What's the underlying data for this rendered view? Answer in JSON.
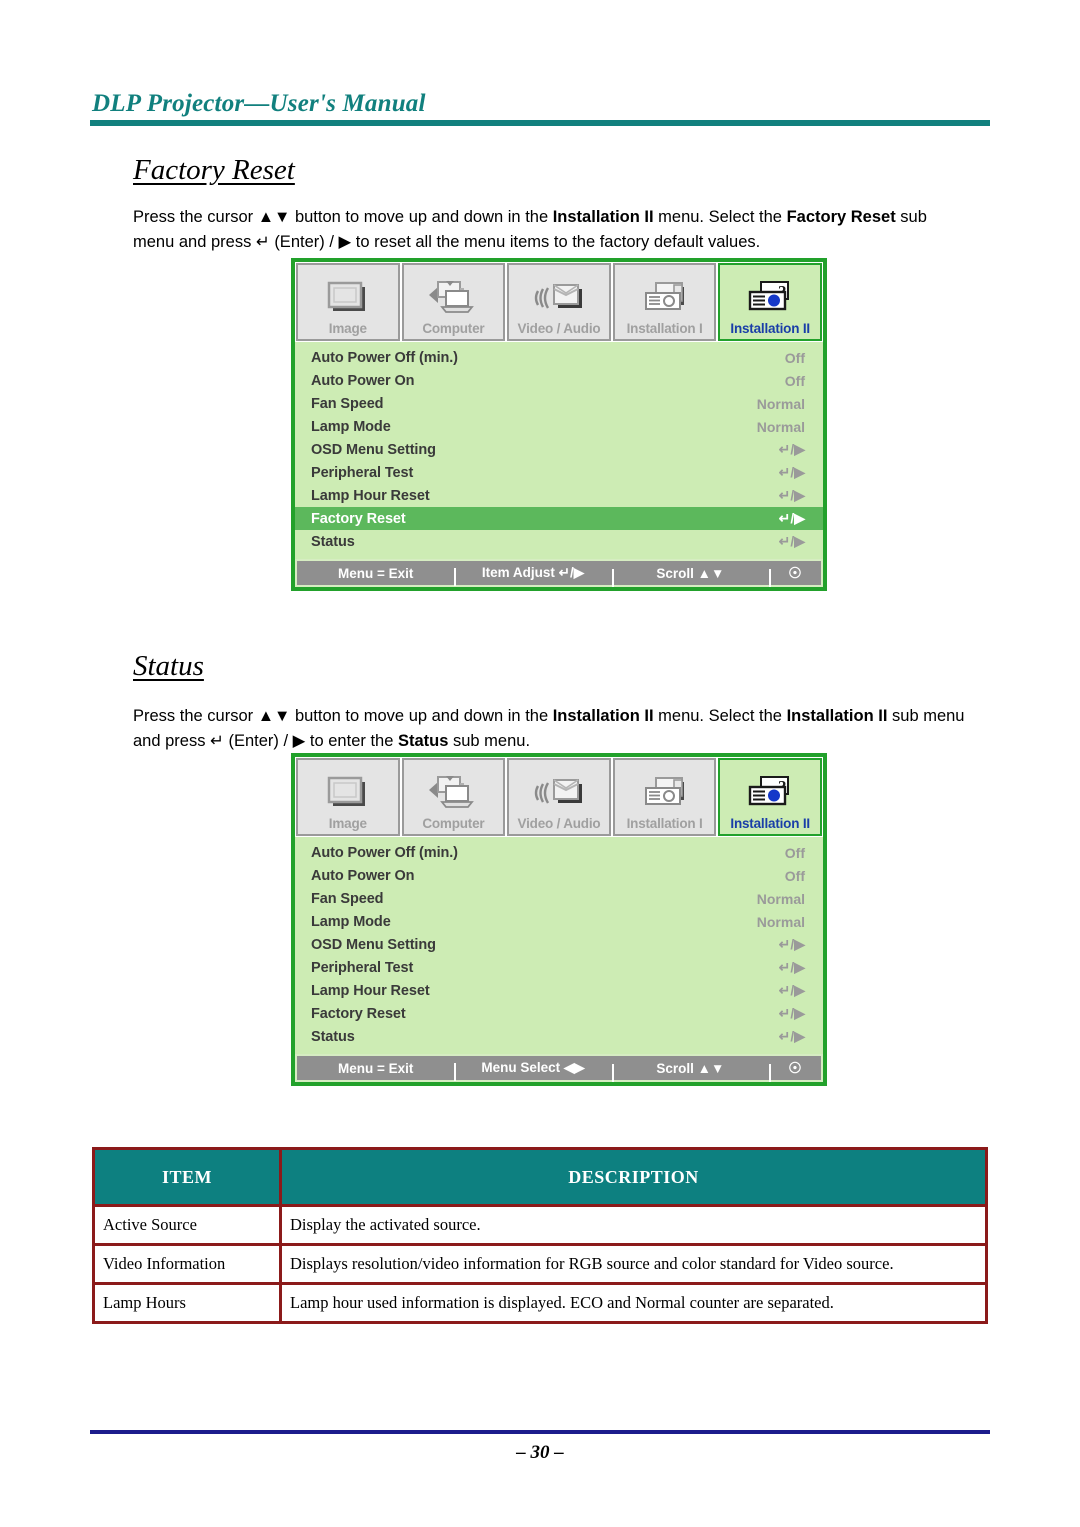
{
  "header": {
    "title": "DLP Projector—User's Manual",
    "rule_color": "#11807e"
  },
  "sections": [
    {
      "heading": "Factory Reset",
      "paragraph_html": "Press the cursor ▲▼ button to move up and down in the <b>Installation II</b> menu. Select the <b>Factory Reset</b> sub menu and press ↵ (Enter) / ▶ to reset all the menu items to the factory default values."
    },
    {
      "heading": "Status",
      "paragraph_html": "Press the cursor ▲▼ button to move up and down in the <b>Installation II</b> menu. Select the <b>Installation II</b> sub menu and press ↵ (Enter) / ▶ to enter the <b>Status</b> sub menu."
    }
  ],
  "osd": {
    "tabs": [
      {
        "label": "Image",
        "icon": "image-screen-icon",
        "active": false
      },
      {
        "label": "Computer",
        "icon": "computer-laptop-icon",
        "active": false
      },
      {
        "label": "Video / Audio",
        "icon": "video-audio-icon",
        "active": false
      },
      {
        "label": "Installation I",
        "icon": "installation-one-icon",
        "active": false
      },
      {
        "label": "Installation II",
        "icon": "installation-two-icon",
        "active": true
      }
    ],
    "items": [
      {
        "label": "Auto Power Off (min.)",
        "value": "Off"
      },
      {
        "label": "Auto Power On",
        "value": "Off"
      },
      {
        "label": "Fan Speed",
        "value": "Normal"
      },
      {
        "label": "Lamp Mode",
        "value": "Normal"
      },
      {
        "label": "OSD Menu Setting",
        "value": "↵/▶"
      },
      {
        "label": "Peripheral Test",
        "value": "↵/▶"
      },
      {
        "label": "Lamp Hour Reset",
        "value": "↵/▶"
      },
      {
        "label": "Factory Reset",
        "value": "↵/▶"
      },
      {
        "label": "Status",
        "value": "↵/▶"
      }
    ],
    "selected_index_first": 7,
    "selected_index_second": -1,
    "footer_first": {
      "exit": "Menu = Exit",
      "middle": "Item Adjust ↵/▶",
      "scroll": "Scroll ▲▼",
      "lamp": "☉"
    },
    "footer_second": {
      "exit": "Menu = Exit",
      "middle": "Menu Select ◀▶",
      "scroll": "Scroll ▲▼",
      "lamp": "☉"
    },
    "colors": {
      "frame_border": "#22a12b",
      "panel_bg": "#cdecb4",
      "selected_row": "#5cb85c",
      "footer_bg": "#8f8f8f",
      "active_tab_text": "#1a3ea8"
    }
  },
  "table": {
    "headers": [
      "ITEM",
      "DESCRIPTION"
    ],
    "rows": [
      [
        "Active Source",
        "Display the activated source."
      ],
      [
        "Video Information",
        "Displays resolution/video information for RGB source and color standard for Video source."
      ],
      [
        "Lamp Hours",
        "Lamp hour used information is displayed. ECO and Normal counter are separated."
      ]
    ],
    "header_bg": "#0d8080",
    "border_color": "#8b1a1a"
  },
  "footer": {
    "page_number": "– 30 –",
    "rule_color": "#1c1c8c"
  }
}
